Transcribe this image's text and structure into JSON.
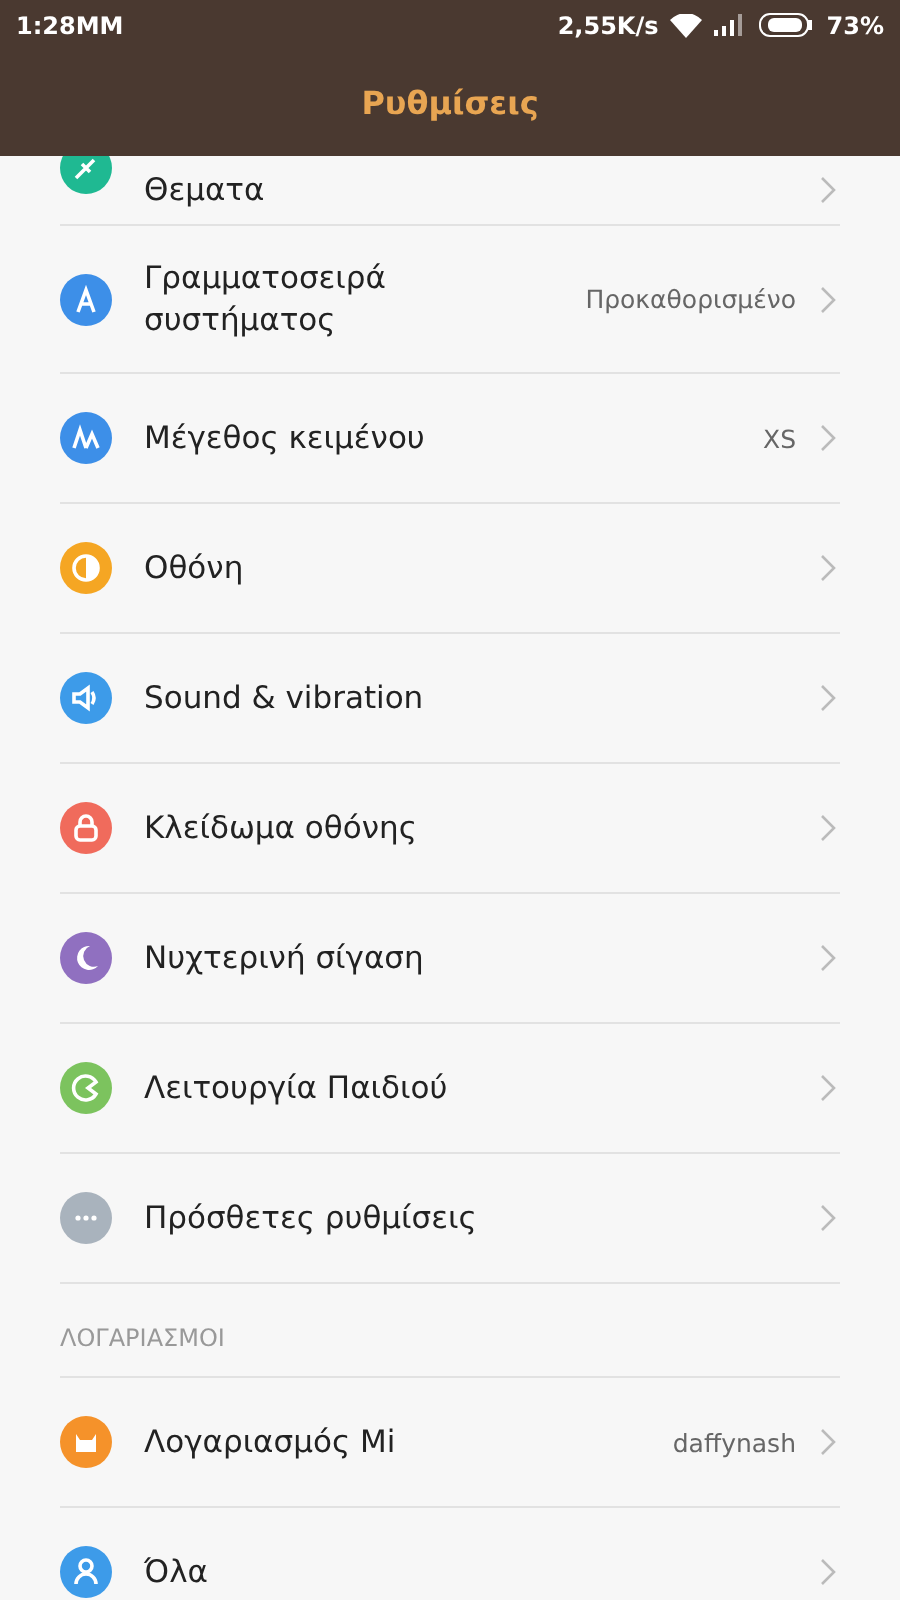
{
  "status_bar": {
    "time": "1:28MM",
    "speed": "2,55K/s",
    "battery": "73%"
  },
  "header": {
    "title": "Ρυθμίσεις"
  },
  "sections": [
    {
      "items": [
        {
          "label": "Θεματα",
          "color": "#1fb992",
          "kind": "cut"
        },
        {
          "label": "Γραμματοσειρά\nσυστήματος",
          "value": "Προκαθορισμένο",
          "color": "#3d8fe8",
          "kind": "tall"
        },
        {
          "label": "Μέγεθος κειμένου",
          "value": "XS",
          "color": "#3d8fe8",
          "kind": "row"
        },
        {
          "label": "Οθόνη",
          "color": "#f5a623",
          "kind": "row"
        },
        {
          "label": "Sound & vibration",
          "color": "#3d9be9",
          "kind": "row"
        },
        {
          "label": "Κλείδωμα οθόνης",
          "color": "#f06b5c",
          "kind": "row"
        },
        {
          "label": "Νυχτερινή σίγαση",
          "color": "#9070c0",
          "kind": "row"
        },
        {
          "label": "Λειτουργία Παιδιού",
          "color": "#7cc35e",
          "kind": "row"
        },
        {
          "label": "Πρόσθετες ρυθμίσεις",
          "color": "#a9b3bd",
          "kind": "row"
        }
      ]
    },
    {
      "title": "ΛΟΓΑΡΙΑΣΜΟΙ",
      "items": [
        {
          "label": "Λογαριασμός Mi",
          "value": "daffynash",
          "color": "#f5922a",
          "kind": "row"
        },
        {
          "label": "Όλα",
          "color": "#3d9be9",
          "kind": "row"
        }
      ]
    }
  ]
}
